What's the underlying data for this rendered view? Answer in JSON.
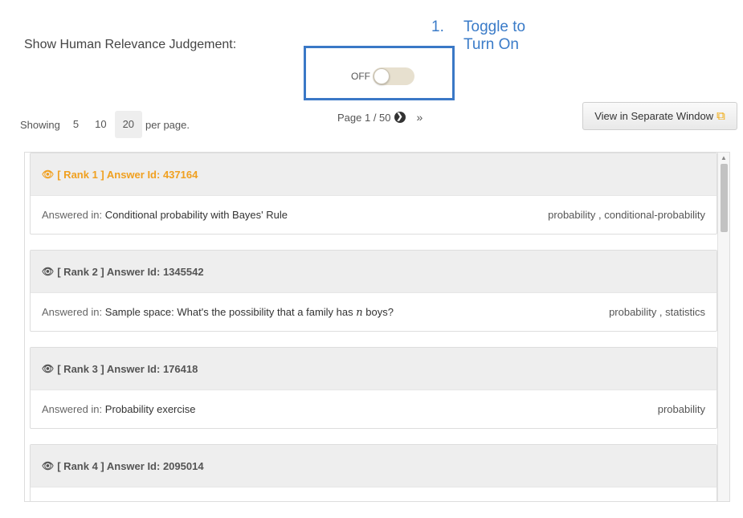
{
  "show_judgement_label": "Show Human Relevance Judgement:",
  "annotation": {
    "number": "1.",
    "line1": "Toggle to",
    "line2": "Turn On"
  },
  "toggle": {
    "state_label": "OFF"
  },
  "pagination": {
    "showing_label": "Showing",
    "options": [
      "5",
      "10",
      "20"
    ],
    "selected": "20",
    "per_page_label": "per page.",
    "page_text": "Page 1 / 50",
    "next_icon": "next-circle-icon",
    "last_icon": "double-chevron-right-icon",
    "last_glyph": "»"
  },
  "separate_window_button": {
    "label": "View in Separate Window",
    "icon": "external-window-icon"
  },
  "results": [
    {
      "title": "[ Rank 1 ] Answer Id: 437164",
      "answered_prefix": "Answered in:",
      "question": "Conditional probability with Bayes' Rule",
      "tags": "probability , conditional-probability"
    },
    {
      "title": "[ Rank 2 ] Answer Id: 1345542",
      "answered_prefix": "Answered in:",
      "question_before": "Sample space: What's the possibility that a family has",
      "question_math": "n",
      "question_after": "boys?",
      "tags": "probability , statistics"
    },
    {
      "title": "[ Rank 3 ] Answer Id: 176418",
      "answered_prefix": "Answered in:",
      "question": "Probability exercise",
      "tags": "probability"
    },
    {
      "title": "[ Rank 4 ] Answer Id: 2095014"
    }
  ],
  "colors": {
    "accent_orange": "#f0a020",
    "annotation_blue": "#3a7bc8",
    "highlight_border": "#3a78c6"
  }
}
